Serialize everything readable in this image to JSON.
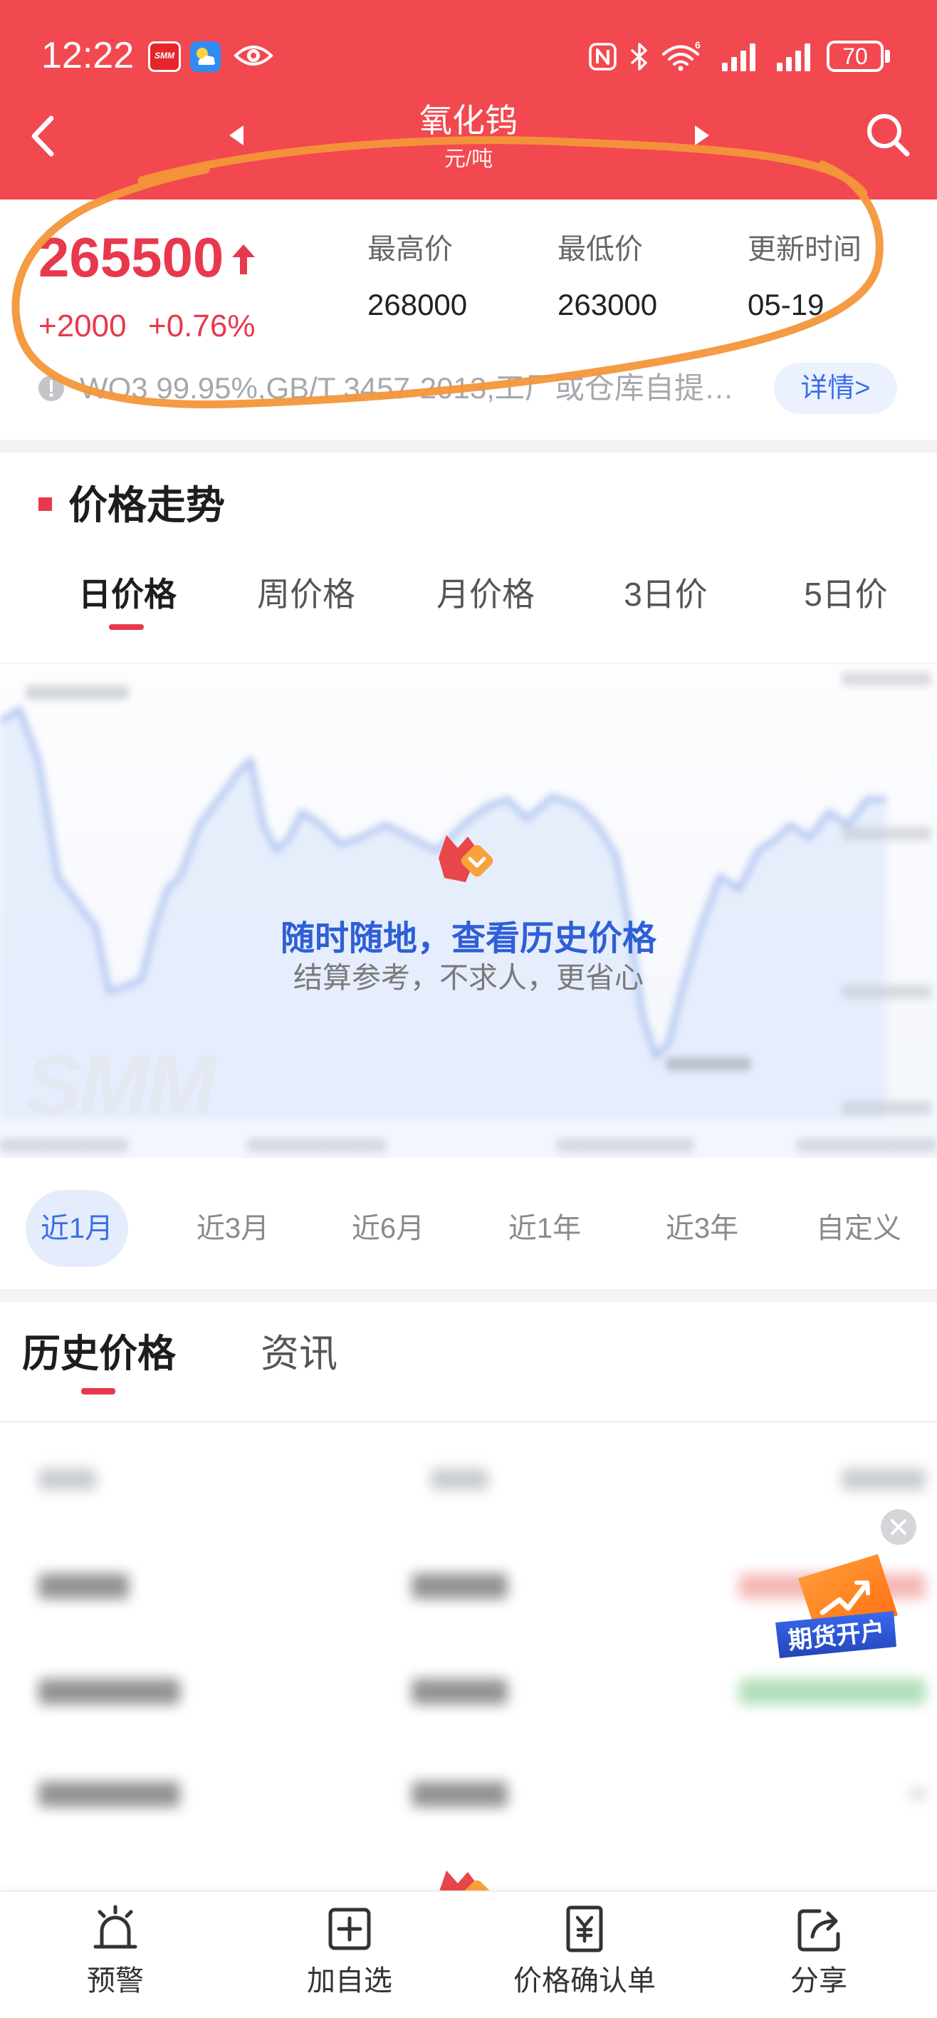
{
  "status_bar": {
    "time": "12:22",
    "app_badge": "SMM",
    "wifi_generation": "6",
    "battery_level": "70"
  },
  "header": {
    "title": "氧化钨",
    "unit": "元/吨"
  },
  "quote": {
    "price": "265500",
    "change": "+2000",
    "change_percent": "+0.76%",
    "stats": [
      {
        "label": "最高价",
        "value": "268000"
      },
      {
        "label": "最低价",
        "value": "263000"
      },
      {
        "label": "更新时间",
        "value": "05-19"
      }
    ],
    "spec": "WO3 99.95%,GB/T 3457-2013,工厂或仓库自提…",
    "details_button": "详情>"
  },
  "trend": {
    "title": "价格走势",
    "tabs": [
      "日价格",
      "周价格",
      "月价格",
      "3日价",
      "5日价"
    ],
    "active_tab_index": 0,
    "overlay_title": "随时随地，查看历史价格",
    "overlay_subtitle": "结算参考，不求人，更省心",
    "watermark": "SMM",
    "ranges": [
      "近1月",
      "近3月",
      "近6月",
      "近1年",
      "近3年",
      "自定义"
    ],
    "active_range_index": 0
  },
  "history": {
    "tabs": [
      "历史价格",
      "资讯"
    ],
    "active_tab_index": 0
  },
  "promo": {
    "label": "期货开户"
  },
  "bottom_nav": [
    {
      "label": "预警",
      "icon": "alarm-icon"
    },
    {
      "label": "加自选",
      "icon": "add-watchlist-icon"
    },
    {
      "label": "价格确认单",
      "icon": "price-confirmation-icon"
    },
    {
      "label": "分享",
      "icon": "share-icon"
    }
  ],
  "colors": {
    "header_red": "#F24850",
    "price_red": "#E8384C",
    "accent_blue": "#3B6FE6",
    "annotation_orange": "#F3963A"
  }
}
